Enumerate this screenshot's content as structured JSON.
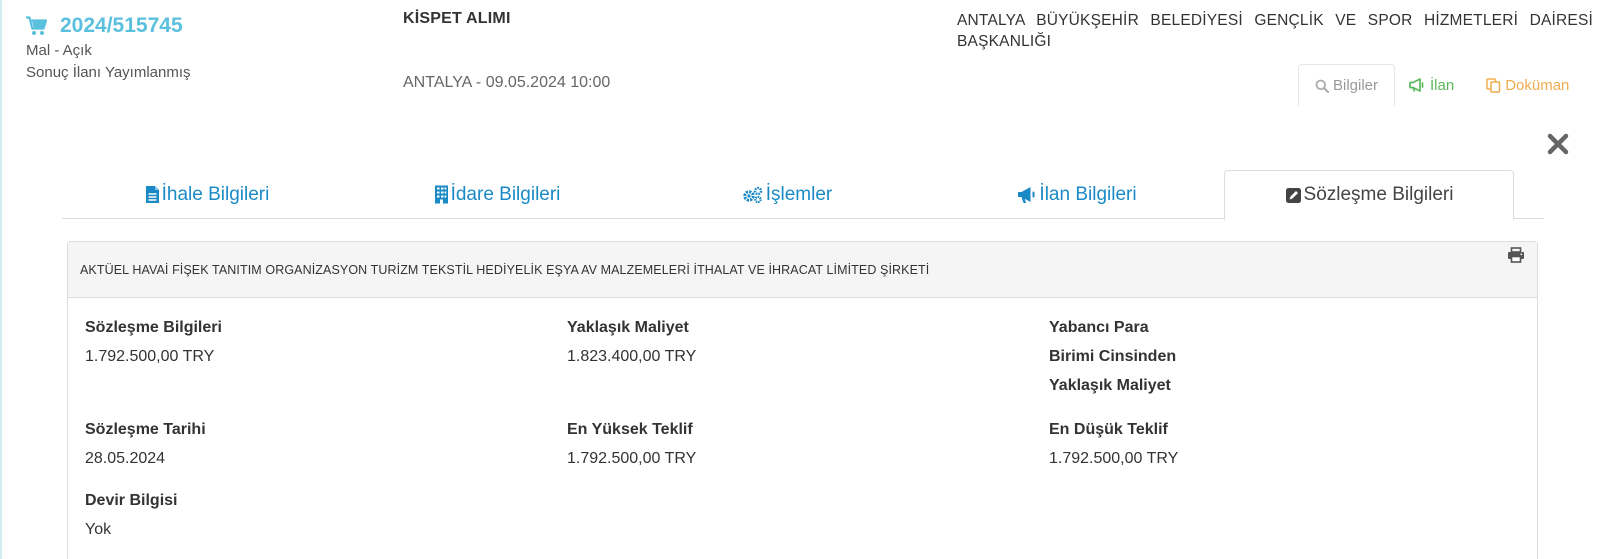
{
  "header": {
    "ikn": "2024/515745",
    "type_method": "Mal - Açık",
    "status": "Sonuç İlanı Yayımlanmış",
    "title": "KİSPET ALIMI",
    "place_date": "ANTALYA - 09.05.2024 10:00",
    "administration": "ANTALYA BÜYÜKŞEHİR BELEDİYESİ GENÇLİK VE SPOR HİZMETLERİ DAİRESİ BAŞKANLIĞI",
    "actions": {
      "info": "Bilgiler",
      "ilan": "İlan",
      "document": "Doküman"
    }
  },
  "tabs": [
    {
      "label": "İhale Bilgileri",
      "icon": "file-text-icon"
    },
    {
      "label": "İdare Bilgileri",
      "icon": "building-icon"
    },
    {
      "label": "İşlemler",
      "icon": "gears-icon"
    },
    {
      "label": "İlan Bilgileri",
      "icon": "bullhorn-icon"
    },
    {
      "label": "Sözleşme Bilgileri",
      "icon": "edit-icon",
      "active": true
    }
  ],
  "contract": {
    "firm": "AKTÜEL HAVAİ FİŞEK TANITIM ORGANİZASYON TURİZM TEKSTİL HEDİYELİK EŞYA AV MALZEMELERİ İTHALAT VE İHRACAT LİMİTED ŞİRKETİ",
    "fields": [
      {
        "label": "Sözleşme Bilgileri",
        "value": "1.792.500,00 TRY"
      },
      {
        "label": "Yaklaşık Maliyet",
        "value": "1.823.400,00 TRY"
      },
      {
        "label_lines": [
          "Yabancı Para",
          "Birimi Cinsinden",
          "Yaklaşık Maliyet"
        ],
        "value": ""
      },
      {
        "label": "Sözleşme Tarihi",
        "value": "28.05.2024"
      },
      {
        "label": "En Yüksek Teklif",
        "value": "1.792.500,00 TRY"
      },
      {
        "label": "En Düşük Teklif",
        "value": "1.792.500,00 TRY"
      },
      {
        "label": "Devir Bilgisi",
        "value": "Yok"
      }
    ]
  },
  "colors": {
    "link": "#1a8ac6",
    "ikn": "#5bc0de",
    "ilan_action": "#5cb85c",
    "document_action": "#f0ad4e"
  }
}
